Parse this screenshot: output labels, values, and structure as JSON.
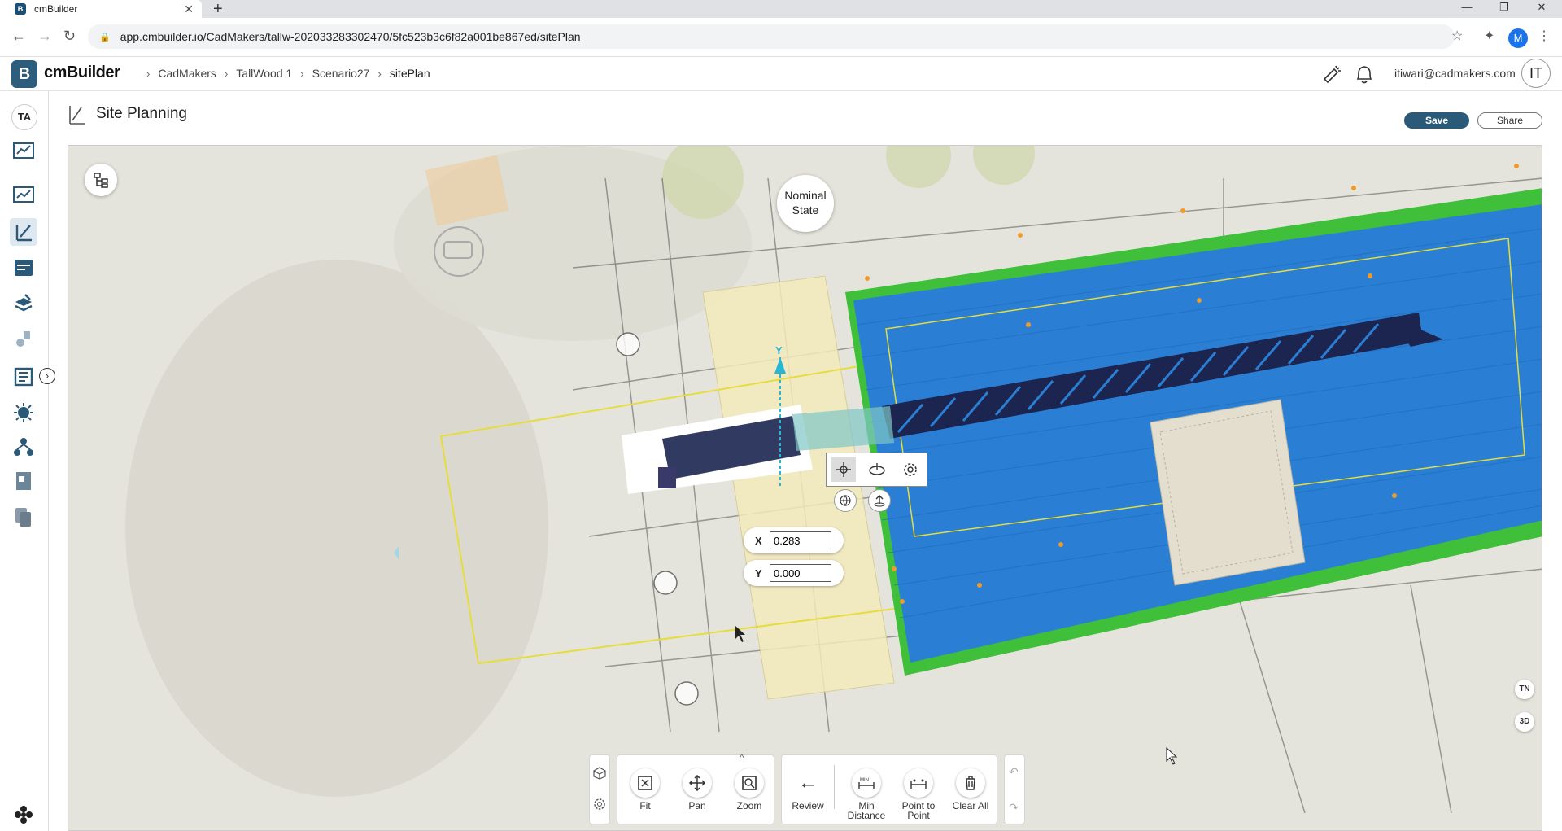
{
  "browser": {
    "tab_title": "cmBuilder",
    "url": "app.cmbuilder.io/CadMakers/tallw-202033283302470/5fc523b3c6f82a001be867ed/sitePlan",
    "profile_initial": "M"
  },
  "app": {
    "logo_mark": "B",
    "logo_text": "cmBuilder",
    "breadcrumbs": [
      "CadMakers",
      "TallWood 1",
      "Scenario27",
      "sitePlan"
    ],
    "user_email": "itiwari@cadmakers.com",
    "user_initials": "IT",
    "rail_initials": "TA"
  },
  "page": {
    "title": "Site Planning",
    "save_label": "Save",
    "share_label": "Share"
  },
  "canvas": {
    "state_label": "Nominal State",
    "axis_label": "Y",
    "coords": {
      "x_label": "X",
      "x_value": "0.283",
      "y_label": "Y",
      "y_value": "0.000"
    },
    "north_label": "TN",
    "view_mode": "3D"
  },
  "toolbar": {
    "view_tools": [
      {
        "label": "Fit",
        "icon": "fit-icon"
      },
      {
        "label": "Pan",
        "icon": "pan-icon"
      },
      {
        "label": "Zoom",
        "icon": "zoom-icon"
      }
    ],
    "review_label": "Review",
    "measure_tools": [
      {
        "label": "Min Distance",
        "icon": "min-distance-icon"
      },
      {
        "label": "Point to Point",
        "icon": "point-to-point-icon"
      },
      {
        "label": "Clear All",
        "icon": "trash-icon"
      }
    ]
  },
  "colors": {
    "brand": "#2b5978",
    "building_roof": "#2a7fd4",
    "crane": "#1b2550",
    "boundary": "#e6dc3c"
  }
}
